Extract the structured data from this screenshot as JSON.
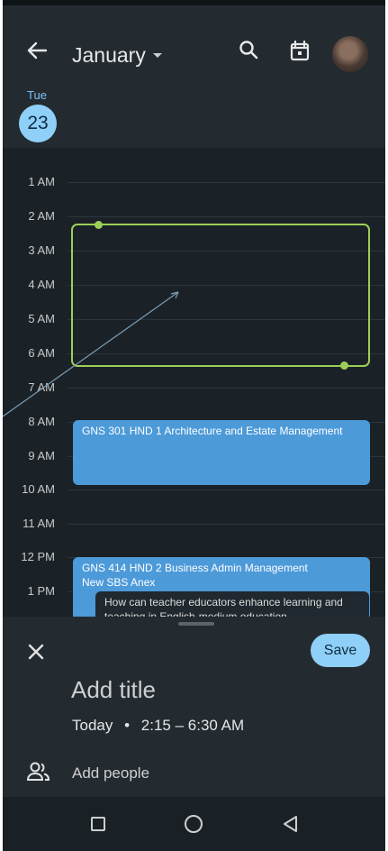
{
  "header": {
    "month": "January",
    "day_name": "Tue",
    "day_number": "23"
  },
  "timeline": {
    "hours": [
      "1 AM",
      "2 AM",
      "3 AM",
      "4 AM",
      "5 AM",
      "6 AM",
      "7 AM",
      "8 AM",
      "9 AM",
      "10 AM",
      "11 AM",
      "12 PM",
      "1 PM"
    ]
  },
  "events": [
    {
      "title": "GNS 301 HND 1 Architecture and Estate Management"
    },
    {
      "title": "GNS 414 HND 2 Business Admin Management",
      "location": "New SBS Anex",
      "nested_title": "How can teacher educators enhance learning and teaching in English-medium education"
    }
  ],
  "sheet": {
    "save_label": "Save",
    "title_placeholder": "Add title",
    "date_label": "Today",
    "separator": "•",
    "time_range": "2:15 – 6:30 AM",
    "add_people_label": "Add people"
  },
  "colors": {
    "accent": "#8fd0f8",
    "event": "#4d9ad9",
    "selection": "#9ccf58",
    "background": "#1b2227"
  }
}
